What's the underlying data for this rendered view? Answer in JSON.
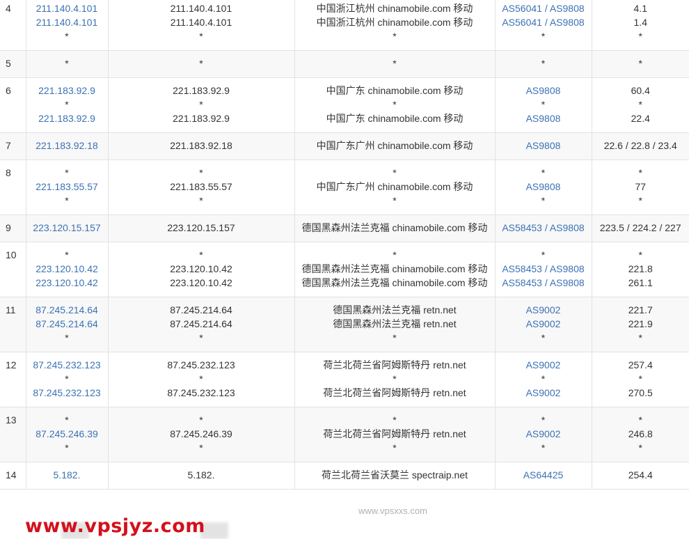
{
  "rows": [
    {
      "hop": "4",
      "ip": [
        "211.140.4.101",
        "211.140.4.101",
        "*"
      ],
      "host": [
        "211.140.4.101",
        "211.140.4.101",
        "*"
      ],
      "loc": [
        "中国浙江杭州 chinamobile.com 移动",
        "中国浙江杭州 chinamobile.com 移动",
        "*"
      ],
      "asn": [
        "AS56041 / AS9808",
        "AS56041 / AS9808",
        "*"
      ],
      "time": [
        "4.1",
        "1.4",
        "*"
      ]
    },
    {
      "hop": "5",
      "ip": [
        "*"
      ],
      "host": [
        "*"
      ],
      "loc": [
        "*"
      ],
      "asn": [
        "*"
      ],
      "time": [
        "*"
      ]
    },
    {
      "hop": "6",
      "ip": [
        "221.183.92.9",
        "*",
        "221.183.92.9"
      ],
      "host": [
        "221.183.92.9",
        "*",
        "221.183.92.9"
      ],
      "loc": [
        "中国广东 chinamobile.com 移动",
        "*",
        "中国广东 chinamobile.com 移动"
      ],
      "asn": [
        "AS9808",
        "*",
        "AS9808"
      ],
      "time": [
        "60.4",
        "*",
        "22.4"
      ]
    },
    {
      "hop": "7",
      "ip": [
        "221.183.92.18"
      ],
      "host": [
        "221.183.92.18"
      ],
      "loc": [
        "中国广东广州 chinamobile.com 移动"
      ],
      "asn": [
        "AS9808"
      ],
      "time": [
        "22.6 / 22.8 / 23.4"
      ]
    },
    {
      "hop": "8",
      "ip": [
        "*",
        "221.183.55.57",
        "*"
      ],
      "host": [
        "*",
        "221.183.55.57",
        "*"
      ],
      "loc": [
        "*",
        "中国广东广州 chinamobile.com 移动",
        "*"
      ],
      "asn": [
        "*",
        "AS9808",
        "*"
      ],
      "time": [
        "*",
        "77",
        "*"
      ]
    },
    {
      "hop": "9",
      "ip": [
        "223.120.15.157"
      ],
      "host": [
        "223.120.15.157"
      ],
      "loc": [
        "德国黑森州法兰克福 chinamobile.com 移动"
      ],
      "asn": [
        "AS58453 / AS9808"
      ],
      "time": [
        "223.5 / 224.2 / 227"
      ]
    },
    {
      "hop": "10",
      "ip": [
        "*",
        "223.120.10.42",
        "223.120.10.42"
      ],
      "host": [
        "*",
        "223.120.10.42",
        "223.120.10.42"
      ],
      "loc": [
        "*",
        "德国黑森州法兰克福 chinamobile.com 移动",
        "德国黑森州法兰克福 chinamobile.com 移动"
      ],
      "asn": [
        "*",
        "AS58453 / AS9808",
        "AS58453 / AS9808"
      ],
      "time": [
        "*",
        "221.8",
        "261.1"
      ]
    },
    {
      "hop": "11",
      "ip": [
        "87.245.214.64",
        "87.245.214.64",
        "*"
      ],
      "host": [
        "87.245.214.64",
        "87.245.214.64",
        "*"
      ],
      "loc": [
        "德国黑森州法兰克福 retn.net",
        "德国黑森州法兰克福 retn.net",
        "*"
      ],
      "asn": [
        "AS9002",
        "AS9002",
        "*"
      ],
      "time": [
        "221.7",
        "221.9",
        "*"
      ]
    },
    {
      "hop": "12",
      "ip": [
        "87.245.232.123",
        "*",
        "87.245.232.123"
      ],
      "host": [
        "87.245.232.123",
        "*",
        "87.245.232.123"
      ],
      "loc": [
        "荷兰北荷兰省阿姆斯特丹 retn.net",
        "*",
        "荷兰北荷兰省阿姆斯特丹 retn.net"
      ],
      "asn": [
        "AS9002",
        "*",
        "AS9002"
      ],
      "time": [
        "257.4",
        "*",
        "270.5"
      ]
    },
    {
      "hop": "13",
      "ip": [
        "*",
        "87.245.246.39",
        "*"
      ],
      "host": [
        "*",
        "87.245.246.39",
        "*"
      ],
      "loc": [
        "*",
        "荷兰北荷兰省阿姆斯特丹 retn.net",
        "*"
      ],
      "asn": [
        "*",
        "AS9002",
        "*"
      ],
      "time": [
        "*",
        "246.8",
        "*"
      ]
    },
    {
      "hop": "14",
      "ip": [
        "5.182."
      ],
      "host": [
        "5.182."
      ],
      "loc": [
        "荷兰北荷兰省沃莫兰 spectraip.net"
      ],
      "asn": [
        "AS64425"
      ],
      "time": [
        "254.4"
      ]
    }
  ],
  "watermarks": {
    "site": "www.vpsjyz.com",
    "small": "www.vpsxxs.com"
  }
}
